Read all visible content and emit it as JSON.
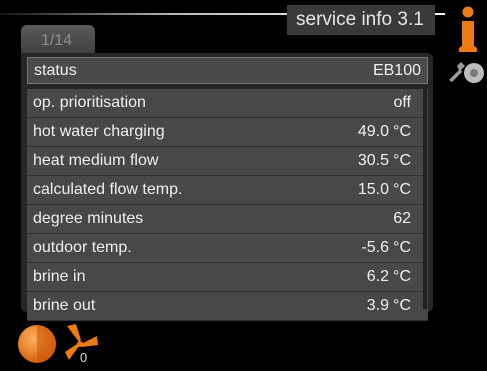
{
  "header": {
    "menu_title": "service info  3.1"
  },
  "icons": {
    "info": "info-icon",
    "tools": "tools-icon",
    "compressor": "compressor-ball-icon",
    "fan": "fan-icon"
  },
  "tab": {
    "label": "1/14"
  },
  "status": {
    "label": "status",
    "value": "EB100"
  },
  "rows": [
    {
      "label": "op. prioritisation",
      "value": "off",
      "unit": ""
    },
    {
      "label": "hot water charging",
      "value": "49.0",
      "unit": "°C"
    },
    {
      "label": "heat medium flow",
      "value": "30.5",
      "unit": "°C"
    },
    {
      "label": "calculated flow temp.",
      "value": "15.0",
      "unit": "°C"
    },
    {
      "label": "degree minutes",
      "value": "62",
      "unit": ""
    },
    {
      "label": "outdoor temp.",
      "value": "-5.6",
      "unit": "°C"
    },
    {
      "label": "brine in",
      "value": "6.2",
      "unit": "°C"
    },
    {
      "label": "brine out",
      "value": "3.9",
      "unit": "°C"
    }
  ],
  "fan_status": {
    "value": "0"
  },
  "colors": {
    "accent_orange": "#ee7a12",
    "row_bg": "#484848",
    "panel_bg": "#262626"
  }
}
